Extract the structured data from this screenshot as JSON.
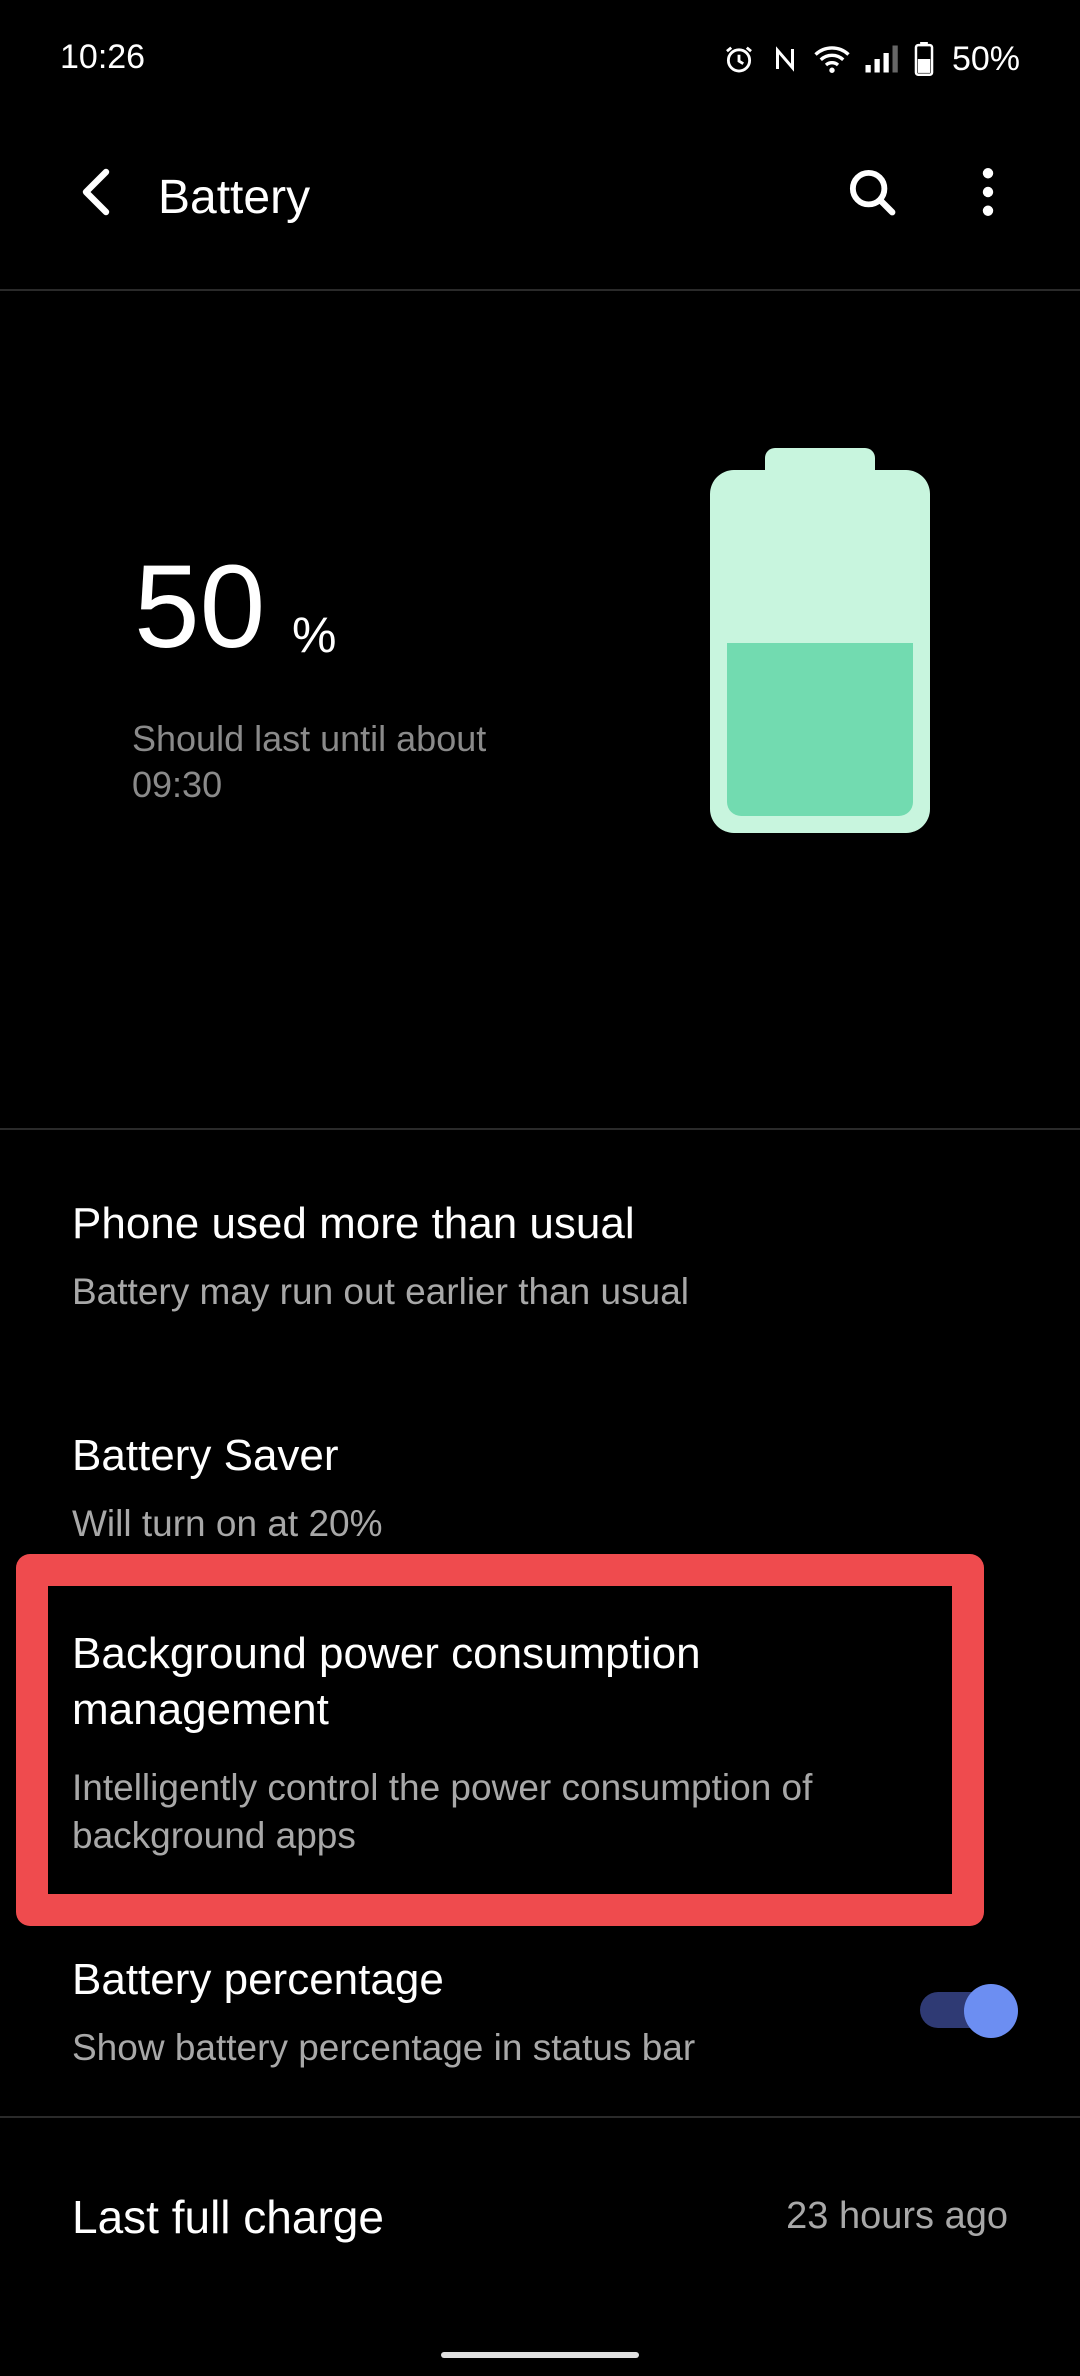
{
  "status_bar": {
    "time": "10:26",
    "battery_percent": "50%",
    "icons": [
      "alarm-icon",
      "nfc-icon",
      "wifi-icon",
      "signal-icon",
      "battery-icon"
    ]
  },
  "app_bar": {
    "title": "Battery",
    "back_icon": "back-arrow-icon",
    "search_icon": "search-icon",
    "more_icon": "more-vert-icon"
  },
  "battery": {
    "level": "50",
    "unit": "%",
    "level_fraction": 0.5,
    "estimate": "Should last until about 09:30",
    "colors": {
      "body": "#c8f5de",
      "fill": "#72dbb0"
    }
  },
  "items": [
    {
      "title": "Phone used more than usual",
      "subtitle": "Battery may run out earlier than usual"
    },
    {
      "title": "Battery Saver",
      "subtitle": "Will turn on at 20%"
    },
    {
      "title": "Background power consumption management",
      "subtitle": "Intelligently control the power consumption of background apps"
    },
    {
      "title": "Battery percentage",
      "subtitle": "Show battery percentage in status bar",
      "toggle_on": true
    }
  ],
  "last_full_charge": {
    "label": "Last full charge",
    "value": "23 hours ago"
  },
  "colors": {
    "highlight": "#ef4b4e",
    "toggle_track": "#2f3a74",
    "toggle_thumb": "#6c8ef2"
  }
}
